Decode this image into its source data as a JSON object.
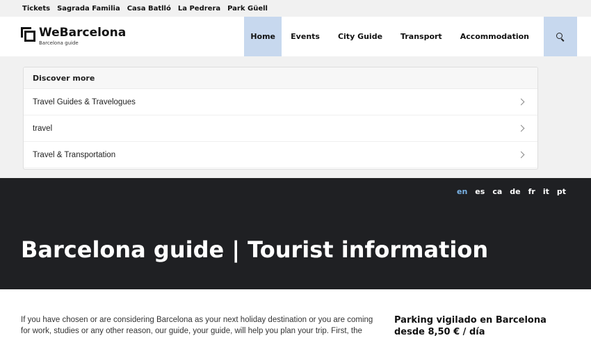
{
  "topbar": {
    "links": [
      "Tickets",
      "Sagrada Familia",
      "Casa Batlló",
      "La Pedrera",
      "Park Güell"
    ]
  },
  "header": {
    "logo_title": "WeBarcelona",
    "logo_subtitle": "Barcelona guide",
    "nav": [
      "Home",
      "Events",
      "City Guide",
      "Transport",
      "Accommodation"
    ],
    "active_nav": "Home",
    "search_icon": "search-icon",
    "accent_color": "#c7d8ee"
  },
  "discover": {
    "heading": "Discover more",
    "items": [
      "Travel Guides & Travelogues",
      "travel",
      "Travel & Transportation"
    ],
    "row_icon": "chevron-right-icon"
  },
  "hero": {
    "languages": [
      "en",
      "es",
      "ca",
      "de",
      "fr",
      "it",
      "pt"
    ],
    "current_language": "en",
    "title": "Barcelona guide | Tourist information",
    "background": "#1f2023"
  },
  "content": {
    "intro": "If you have chosen or are considering Barcelona as your next holiday destination or you are coming for work, studies or any other reason, our guide, your guide, will help you plan your trip. First, the",
    "aside_title": "Parking vigilado en Barcelona desde 8,50 € / día"
  }
}
